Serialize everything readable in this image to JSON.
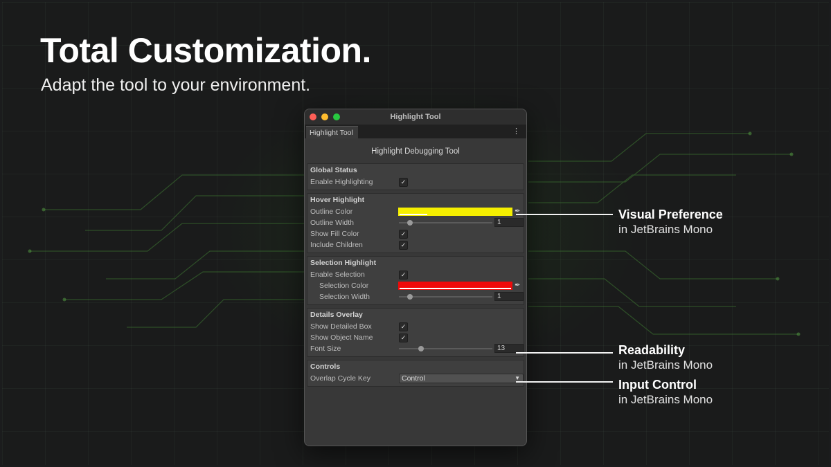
{
  "hero": {
    "title": "Total Customization.",
    "subtitle": "Adapt the tool to your environment."
  },
  "window": {
    "title": "Highlight Tool",
    "tab_label": "Highlight Tool",
    "menu_icon": "kebab-menu-icon",
    "heading": "Highlight Debugging Tool",
    "sections": {
      "global": {
        "title": "Global Status",
        "enable_highlighting": {
          "label": "Enable Highlighting",
          "checked": true
        }
      },
      "hover": {
        "title": "Hover Highlight",
        "outline_color": {
          "label": "Outline Color",
          "color": "#f5ef00"
        },
        "outline_width": {
          "label": "Outline Width",
          "value": "1"
        },
        "show_fill_color": {
          "label": "Show Fill Color",
          "checked": true
        },
        "include_children": {
          "label": "Include Children",
          "checked": true
        }
      },
      "selection": {
        "title": "Selection Highlight",
        "enable_selection": {
          "label": "Enable Selection",
          "checked": true
        },
        "selection_color": {
          "label": "Selection Color",
          "color": "#ee0a0a"
        },
        "selection_width": {
          "label": "Selection Width",
          "value": "1"
        }
      },
      "details": {
        "title": "Details Overlay",
        "show_detailed_box": {
          "label": "Show Detailed Box",
          "checked": true
        },
        "show_object_name": {
          "label": "Show Object Name",
          "checked": true
        },
        "font_size": {
          "label": "Font Size",
          "value": "13"
        }
      },
      "controls": {
        "title": "Controls",
        "overlap_cycle_key": {
          "label": "Overlap Cycle Key",
          "value": "Control"
        }
      }
    }
  },
  "callouts": {
    "visual": {
      "title": "Visual Preference",
      "sub": "in JetBrains Mono"
    },
    "readability": {
      "title": "Readability",
      "sub": "in JetBrains Mono"
    },
    "input": {
      "title": "Input Control",
      "sub": "in JetBrains Mono"
    }
  },
  "check_glyph": "✓",
  "eyedropper_glyph": "✒",
  "caret_glyph": "▼",
  "kebab_glyph": "⋮",
  "colors": {
    "accent_green": "#28c840",
    "bg": "#1a1b1b"
  }
}
